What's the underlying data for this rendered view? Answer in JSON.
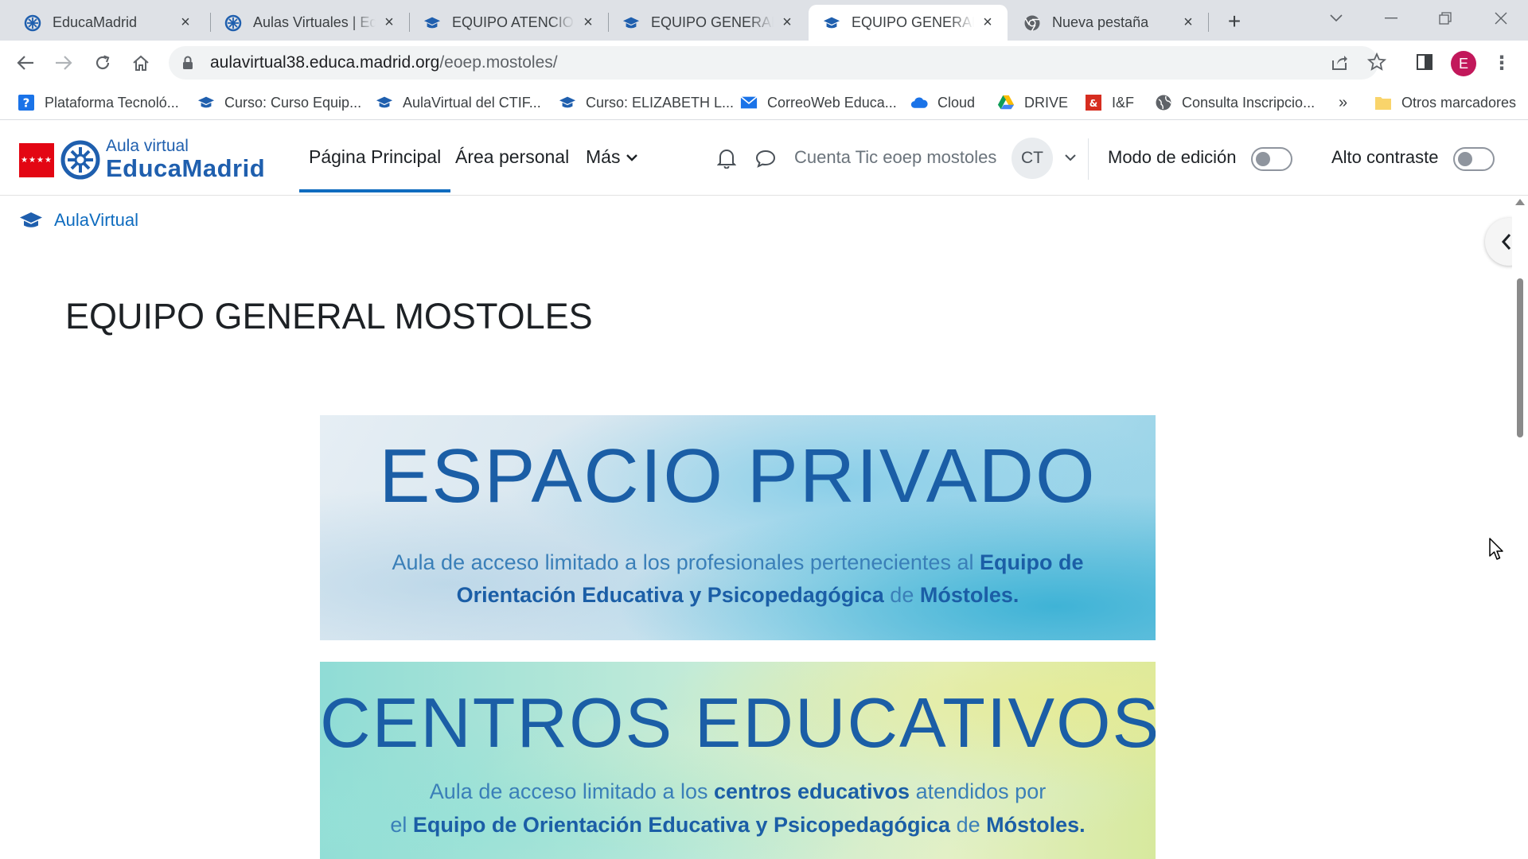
{
  "browser": {
    "tabs": [
      {
        "title": "EducaMadrid",
        "icon": "educamadrid-icon",
        "active": false
      },
      {
        "title": "Aulas Virtuales | EducaMadrid",
        "icon": "educamadrid-icon",
        "active": false
      },
      {
        "title": "EQUIPO ATENCION",
        "icon": "moodle-cap-icon",
        "active": false
      },
      {
        "title": "EQUIPO GENERAL AT",
        "icon": "moodle-cap-icon",
        "active": false
      },
      {
        "title": "EQUIPO GENERAL MOSTOLES",
        "icon": "moodle-cap-icon",
        "active": true
      },
      {
        "title": "Nueva pestaña",
        "icon": "chrome-icon",
        "active": false
      }
    ],
    "url_host": "aulavirtual38.educa.madrid.org",
    "url_path": "/eoep.mostoles/",
    "profile_initial": "E",
    "bookmarks": [
      {
        "label": "Plataforma Tecnoló...",
        "icon": "help-square-icon"
      },
      {
        "label": "Curso: Curso Equip...",
        "icon": "moodle-cap-icon"
      },
      {
        "label": "AulaVirtual del CTIF...",
        "icon": "moodle-cap-icon"
      },
      {
        "label": "Curso: ELIZABETH L...",
        "icon": "moodle-cap-icon"
      },
      {
        "label": "CorreoWeb Educa...",
        "icon": "mail-icon"
      },
      {
        "label": "Cloud",
        "icon": "cloud-icon"
      },
      {
        "label": "DRIVE",
        "icon": "drive-icon"
      },
      {
        "label": "I&F",
        "icon": "if-logo-icon"
      },
      {
        "label": "Consulta Inscripcio...",
        "icon": "globe-icon"
      }
    ],
    "bookmarks_more": "»",
    "other_bookmarks": "Otros marcadores"
  },
  "site": {
    "logo_small": "Aula virtual",
    "logo_big": "EducaMadrid",
    "nav": {
      "home": "Página Principal",
      "personal": "Área personal",
      "more": "Más"
    },
    "account_name": "Cuenta Tic eoep mostoles",
    "avatar_initials": "CT",
    "edit_mode_label": "Modo de edición",
    "high_contrast_label": "Alto contraste"
  },
  "breadcrumb": {
    "label": "AulaVirtual"
  },
  "page": {
    "title": "EQUIPO GENERAL MOSTOLES"
  },
  "banners": {
    "private": {
      "heading": "ESPACIO PRIVADO",
      "line1_a": "Aula de acceso limitado a los profesionales pertenecientes al ",
      "line1_b": "Equipo de",
      "line2_a": "Orientación Educativa y Psicopedagógica",
      "line2_b": " de ",
      "line2_c": "Móstoles."
    },
    "schools": {
      "heading": "CENTROS EDUCATIVOS",
      "line1_a": "Aula de acceso limitado a los ",
      "line1_b": "centros educativos",
      "line1_c": " atendidos por",
      "line2_a": "el ",
      "line2_b": "Equipo de Orientación Educativa y Psicopedagógica",
      "line2_c": " de ",
      "line2_d": "Móstoles."
    }
  },
  "colors": {
    "brand_blue": "#1f5fae",
    "link_blue": "#0f6cbf",
    "madrid_red": "#e30613"
  }
}
